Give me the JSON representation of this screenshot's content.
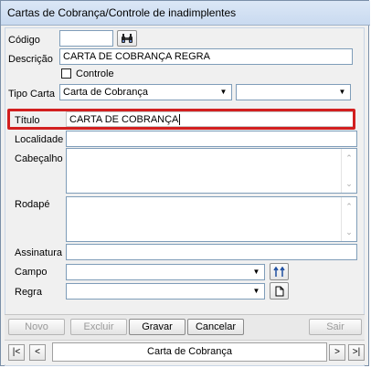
{
  "window": {
    "title": "Cartas de Cobrança/Controle de inadimplentes"
  },
  "form": {
    "codigo_label": "Código",
    "codigo_value": "",
    "descricao_label": "Descrição",
    "descricao_value": "CARTA DE COBRANÇA REGRA",
    "controle_label": "Controle",
    "tipo_label": "Tipo Carta",
    "tipo_value": "Carta de Cobrança",
    "tipo_value2": "",
    "titulo_label": "Título",
    "titulo_value": "CARTA DE COBRANÇA",
    "localidade_label": "Localidade",
    "localidade_value": "",
    "cabecalho_label": "Cabeçalho",
    "rodape_label": "Rodapé",
    "assinatura_label": "Assinatura",
    "assinatura_value": "",
    "campo_label": "Campo",
    "campo_value": "",
    "regra_label": "Regra",
    "regra_value": ""
  },
  "buttons": {
    "novo": "Novo",
    "excluir": "Excluir",
    "gravar": "Gravar",
    "cancelar": "Cancelar",
    "sair": "Sair"
  },
  "navigator": {
    "current": "Carta de Cobrança",
    "first": "|<",
    "prev": "<",
    "next": ">",
    "last": ">|"
  },
  "colors": {
    "highlight": "#d21f1f",
    "accent_blue": "#1f4fa0"
  }
}
